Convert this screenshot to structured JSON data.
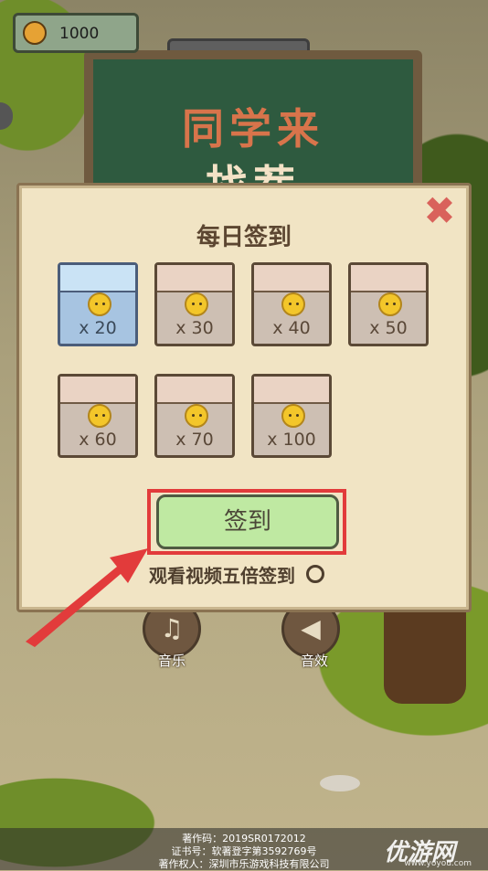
{
  "hud": {
    "coins": "1000"
  },
  "board": {
    "line1": "同学来",
    "line2": "找茬"
  },
  "dialog": {
    "title": "每日签到",
    "close_icon": "close-x-icon",
    "rewards": [
      {
        "amount": "x 20",
        "active": true
      },
      {
        "amount": "x 30",
        "active": false
      },
      {
        "amount": "x 40",
        "active": false
      },
      {
        "amount": "x 50",
        "active": false
      },
      {
        "amount": "x 60",
        "active": false
      },
      {
        "amount": "x 70",
        "active": false
      },
      {
        "amount": "x 100",
        "active": false
      }
    ],
    "signin_label": "签到",
    "video_option_label": "观看视频五倍签到"
  },
  "buttons": {
    "music_label": "音乐",
    "sound_label": "音效"
  },
  "footer": {
    "line1": "著作码：2019SR0172012",
    "line2": "证书号：软著登字第3592769号",
    "line3": "著作权人：深圳市乐游戏科技有限公司"
  },
  "watermark": {
    "main": "优游网",
    "sub": "www.yoyou.com"
  },
  "colors": {
    "highlight_red": "#e23b3b",
    "signin_green": "#bfe9a2",
    "active_card_blue": "#a7c4e1"
  }
}
